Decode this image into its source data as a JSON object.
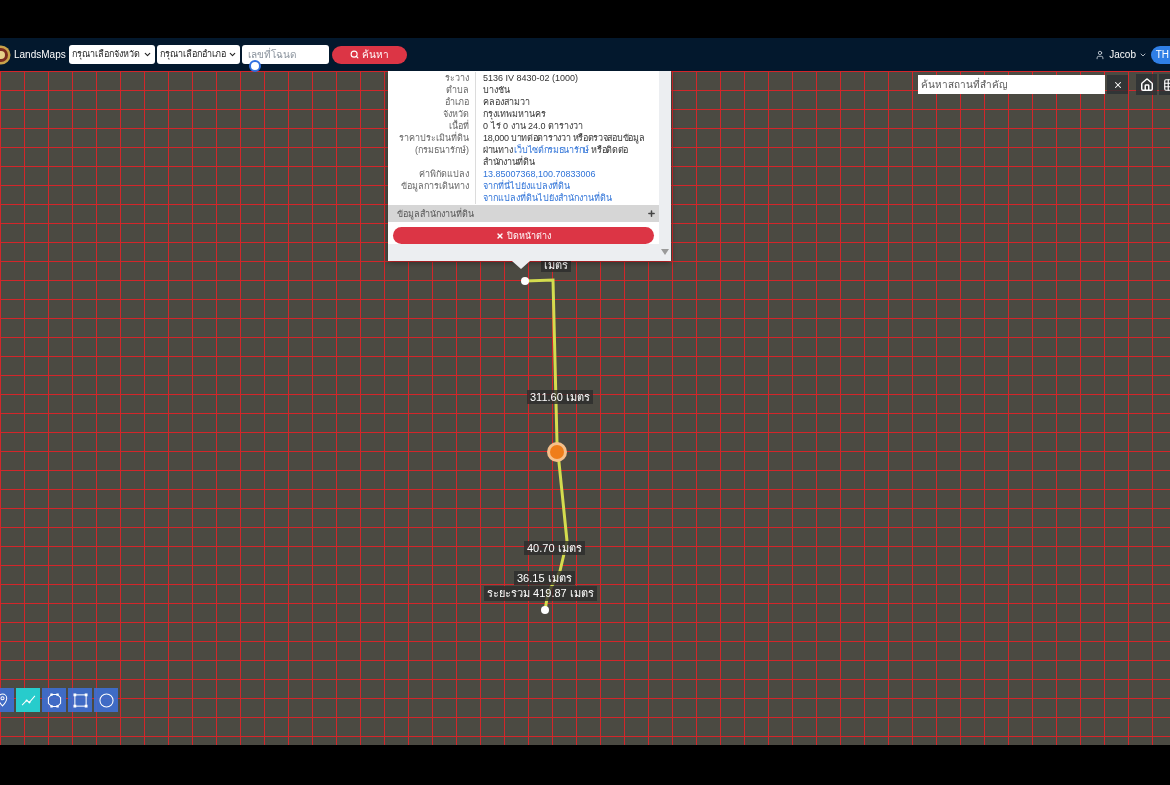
{
  "navbar": {
    "brand": "LandsMaps",
    "province_select": "กรุณาเลือกจังหวัด",
    "district_select": "กรุณาเลือกอำเภอ",
    "deed_input": {
      "placeholder": "เลขที่โฉนด"
    },
    "search_button": "ค้นหา",
    "user": "Jacob",
    "language": "TH"
  },
  "landmark_search": {
    "placeholder": "ค้นหาสถานที่สำคัญ"
  },
  "parcel_popup": {
    "rows": [
      {
        "kind": "text",
        "label": "ระวาง",
        "value": "5136 IV 8430-02 (1000)"
      },
      {
        "kind": "text",
        "label": "ตำบล",
        "value": "บางชัน"
      },
      {
        "kind": "text",
        "label": "อำเภอ",
        "value": "คลองสามวา"
      },
      {
        "kind": "text",
        "label": "จังหวัด",
        "value": "กรุงเทพมหานคร"
      },
      {
        "kind": "text",
        "label": "เนื้อที่",
        "value": "0 ไร่ 0 งาน 24.0 ตารางวา"
      },
      {
        "kind": "text_link",
        "label": "ราคาประเมินที่ดิน (กรมธนารักษ์)",
        "before": "18,000 บาทต่อตารางวา หรือตรวจสอบข้อมูลผ่านทาง",
        "link": "เว็บไซต์กรมธนารักษ์",
        "after": "หรือติดต่อสำนักงานที่ดิน"
      },
      {
        "kind": "links",
        "label": "ค่าพิกัดแปลง",
        "links": [
          "13.85007368,100.70833006"
        ]
      },
      {
        "kind": "links",
        "label": "ข้อมูลการเดินทาง",
        "links": [
          "จากที่นี่ไปยังแปลงที่ดิน",
          "จากแปลงที่ดินไปยังสำนักงานที่ดิน"
        ]
      }
    ],
    "section": {
      "title": "ข้อมูลสำนักงานที่ดิน",
      "expanded": false
    },
    "close_button": "ปิดหน้าต่าง"
  },
  "measurement": {
    "segments": [
      "เมตร",
      "311.60 เมตร",
      "40.70 เมตร",
      "36.15 เมตร"
    ],
    "total": "ระยะรวม 419.87 เมตร"
  },
  "tools": [
    {
      "kind": "marker",
      "selected": false
    },
    {
      "kind": "measure",
      "selected": true
    },
    {
      "kind": "polygon",
      "selected": false
    },
    {
      "kind": "rectangle",
      "selected": false
    },
    {
      "kind": "circle",
      "selected": false
    }
  ]
}
